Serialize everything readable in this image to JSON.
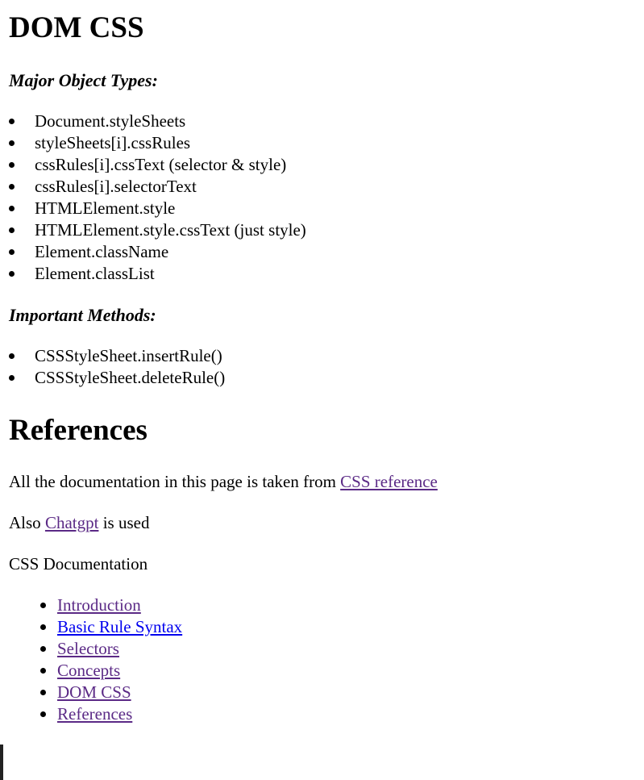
{
  "section_dom": {
    "title": "DOM CSS",
    "object_types_heading": "Major Object Types:",
    "object_types": [
      "Document.styleSheets",
      "styleSheets[i].cssRules",
      "cssRules[i].cssText (selector & style)",
      "cssRules[i].selectorText",
      "HTMLElement.style",
      "HTMLElement.style.cssText (just style)",
      "Element.className",
      "Element.classList"
    ],
    "methods_heading": "Important Methods:",
    "methods": [
      "CSSStyleSheet.insertRule()",
      "CSSStyleSheet.deleteRule()"
    ]
  },
  "section_refs": {
    "title": "References",
    "para1_prefix": "All the documentation in this page is taken from ",
    "para1_link": "CSS reference",
    "para2_prefix": "Also ",
    "para2_link": "Chatgpt",
    "para2_suffix": " is used"
  },
  "toc": {
    "heading": "CSS Documentation",
    "items": [
      {
        "label": "Introduction"
      },
      {
        "label": "Basic Rule Syntax"
      },
      {
        "label": "Selectors"
      },
      {
        "label": "Concepts"
      },
      {
        "label": "DOM CSS"
      },
      {
        "label": "References"
      }
    ]
  },
  "colors": {
    "visited_link": "#5b2a86",
    "unvisited_link": "#0000ee",
    "text": "#000000"
  }
}
